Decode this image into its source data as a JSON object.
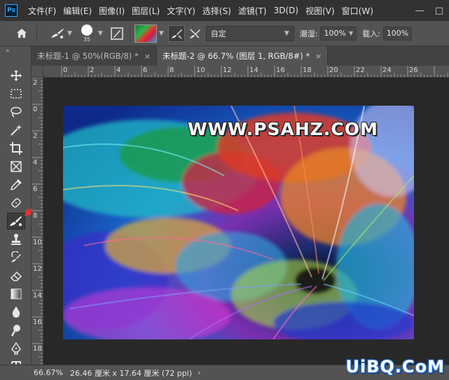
{
  "app": {
    "logo_text": "Ps"
  },
  "menu": {
    "items": [
      "文件(F)",
      "编辑(E)",
      "图像(I)",
      "图层(L)",
      "文字(Y)",
      "选择(S)",
      "滤镜(T)",
      "3D(D)",
      "视图(V)",
      "窗口(W)"
    ]
  },
  "window_controls": {
    "minimize": "—",
    "maximize": "□",
    "close": "✕"
  },
  "options": {
    "brush_size": "35",
    "mode_value": "自定",
    "flow_label": "潮湿:",
    "flow_value": "100%",
    "load_label": "载入:",
    "load_value": "100%"
  },
  "tabs": [
    {
      "label": "未标题-1 @ 50%(RGB/8) *",
      "close": "×",
      "active": false
    },
    {
      "label": "未标题-2 @ 66.7% (图层 1, RGB/8#) *",
      "close": "×",
      "active": true
    }
  ],
  "ruler": {
    "h_labels": [
      "0",
      "2",
      "4",
      "6",
      "8",
      "10",
      "12",
      "14",
      "16",
      "18",
      "20",
      "22",
      "24",
      "26"
    ],
    "v_labels": [
      "2",
      "0",
      "2",
      "4",
      "6",
      "8",
      "10",
      "12",
      "14",
      "16",
      "18"
    ]
  },
  "canvas": {
    "watermark": "WWW.PSAHZ.COM"
  },
  "status": {
    "zoom": "66.67%",
    "doc_info": "26.46 厘米 x 17.64 厘米 (72 ppi)",
    "more": "›"
  },
  "site_watermark": "UiBQ.CoM",
  "tools": [
    "move-tool",
    "marquee-tool",
    "lasso-tool",
    "magic-wand-tool",
    "crop-tool",
    "frame-tool",
    "eyedropper-tool",
    "healing-brush-tool",
    "mixer-brush-tool",
    "clone-stamp-tool",
    "history-brush-tool",
    "eraser-tool",
    "gradient-tool",
    "blur-tool",
    "dodge-tool",
    "pen-tool",
    "type-tool"
  ],
  "colors": {
    "accent": "#31a8ff",
    "arrow": "#e8322c",
    "background": "#535353",
    "pasteboard": "#282828"
  }
}
